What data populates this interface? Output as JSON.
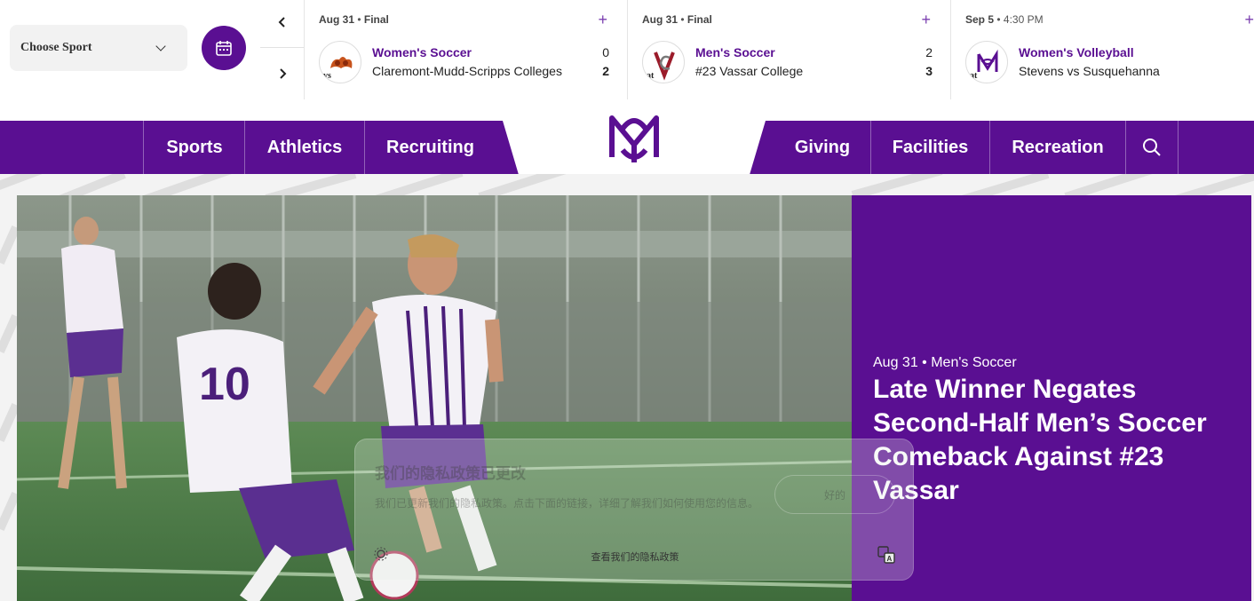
{
  "scoreboard": {
    "choose_sport": "Choose Sport",
    "prev_arrow": "‹",
    "next_arrow": "›",
    "games": [
      {
        "date": "Aug 31",
        "status": "Final",
        "sport": "Women's Soccer",
        "vs_at": "vs",
        "opponent": "Claremont-Mudd-Scripps Colleges",
        "score_home": "0",
        "score_away": "2",
        "plus": "+"
      },
      {
        "date": "Aug 31",
        "status": "Final",
        "sport": "Men's Soccer",
        "vs_at": "at",
        "opponent": "#23 Vassar College",
        "score_home": "2",
        "score_away": "3",
        "plus": "+"
      },
      {
        "date": "Sep 5",
        "status": "4:30 PM",
        "sport": "Women's Volleyball",
        "vs_at": "at",
        "opponent": "Stevens vs Susquehanna",
        "plus": "+"
      }
    ]
  },
  "nav": {
    "items_left": [
      "Sports",
      "Athletics",
      "Recruiting"
    ],
    "items_right": [
      "Giving",
      "Facilities",
      "Recreation"
    ]
  },
  "hero": {
    "date": "Aug 31",
    "sport": "Men's Soccer",
    "headline": "Late Winner Negates Second-Half Men’s Soccer Comeback Against #23 Vassar"
  },
  "toast": {
    "title": "我们的隐私政策已更改",
    "body": "我们已更新我们的隐私政策。点击下面的链接，详细了解我们如何使用您的信息。",
    "ok": "好的",
    "link": "查看我们的隐私政策"
  },
  "colors": {
    "brand_purple": "#5a0f92",
    "accent_purple": "#7b3fb0"
  }
}
